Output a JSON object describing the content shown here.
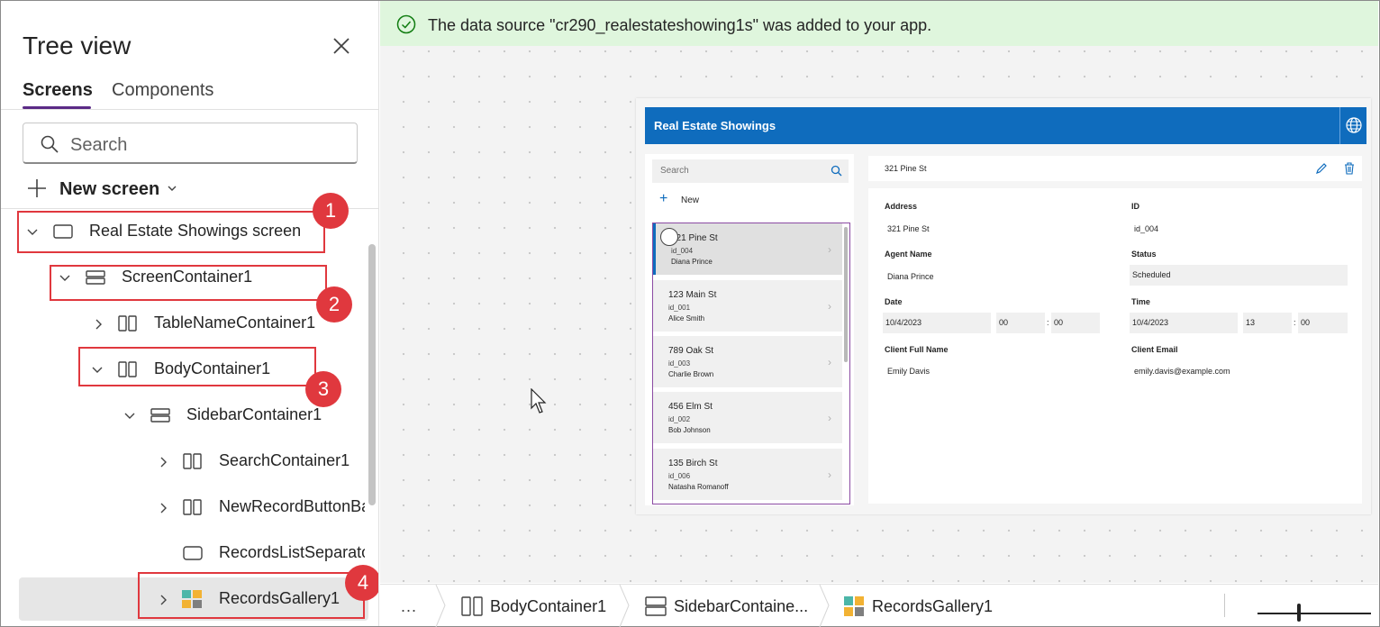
{
  "tree": {
    "title": "Tree view",
    "tabs": [
      "Screens",
      "Components"
    ],
    "search_placeholder": "Search",
    "new_screen": "New screen",
    "nodes": [
      {
        "label": "Real Estate Showings screen",
        "icon": "screen-icon",
        "expanded": true
      },
      {
        "label": "ScreenContainer1",
        "icon": "vertical-container-icon",
        "expanded": true
      },
      {
        "label": "TableNameContainer1",
        "icon": "horizontal-container-icon",
        "expanded": false
      },
      {
        "label": "BodyContainer1",
        "icon": "horizontal-container-icon",
        "expanded": true
      },
      {
        "label": "SidebarContainer1",
        "icon": "vertical-container-icon",
        "expanded": true
      },
      {
        "label": "SearchContainer1",
        "icon": "horizontal-container-icon",
        "expanded": false
      },
      {
        "label": "NewRecordButtonBa",
        "icon": "horizontal-container-icon",
        "expanded": false
      },
      {
        "label": "RecordsListSeparato",
        "icon": "rectangle-icon",
        "expanded": null
      },
      {
        "label": "RecordsGallery1",
        "icon": "gallery-icon",
        "expanded": false,
        "selected": true
      }
    ],
    "callouts": [
      "1",
      "2",
      "3",
      "4"
    ]
  },
  "notice": {
    "text": "The data source \"cr290_realestateshowing1s\" was added to your app.",
    "color": "#dff6dd"
  },
  "app": {
    "title": "Real Estate Showings",
    "header_color": "#0f6cbd",
    "search_placeholder": "Search",
    "new_label": "New",
    "records": [
      {
        "address": "321 Pine St",
        "id": "id_004",
        "agent": "Diana Prince"
      },
      {
        "address": "123 Main St",
        "id": "id_001",
        "agent": "Alice Smith"
      },
      {
        "address": "789 Oak St",
        "id": "id_003",
        "agent": "Charlie Brown"
      },
      {
        "address": "456 Elm St",
        "id": "id_002",
        "agent": "Bob Johnson"
      },
      {
        "address": "135 Birch St",
        "id": "id_006",
        "agent": "Natasha Romanoff"
      }
    ],
    "detail": {
      "title": "321 Pine St",
      "address_label": "Address",
      "address": "321 Pine St",
      "id_label": "ID",
      "id": "id_004",
      "agent_label": "Agent Name",
      "agent": "Diana Prince",
      "status_label": "Status",
      "status": "Scheduled",
      "date_label": "Date",
      "date": "10/4/2023",
      "date_hour": "00",
      "date_min": "00",
      "time_label": "Time",
      "time_date": "10/4/2023",
      "time_hour": "13",
      "time_min": "00",
      "client_name_label": "Client Full Name",
      "client_name": "Emily Davis",
      "client_email_label": "Client Email",
      "client_email": "emily.davis@example.com",
      "colon": ":"
    }
  },
  "breadcrumb": {
    "more": "...",
    "items": [
      {
        "label": "BodyContainer1",
        "icon": "horizontal-container-icon"
      },
      {
        "label": "SidebarContaine...",
        "icon": "vertical-container-icon"
      },
      {
        "label": "RecordsGallery1",
        "icon": "gallery-icon"
      }
    ]
  }
}
